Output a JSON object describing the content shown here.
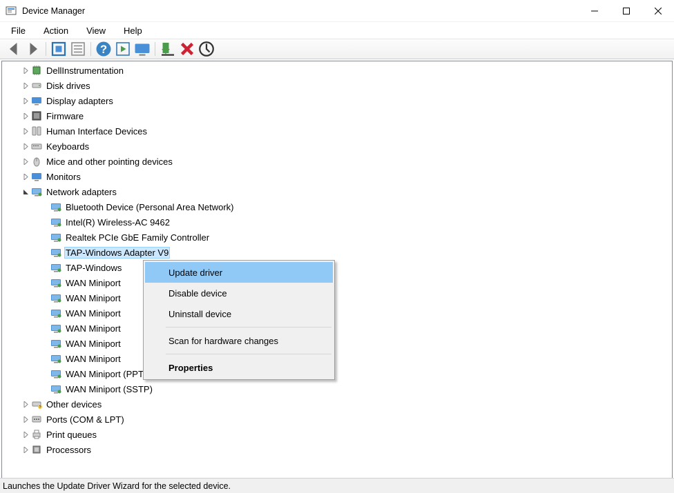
{
  "window": {
    "title": "Device Manager"
  },
  "menu": {
    "items": [
      "File",
      "Action",
      "View",
      "Help"
    ]
  },
  "toolbar": {
    "back": "back",
    "forward": "forward",
    "show_hidden": "show-hidden",
    "properties": "properties",
    "help": "help",
    "action": "action",
    "monitor": "monitor",
    "install": "install",
    "delete": "delete",
    "scan": "scan"
  },
  "tree": {
    "categories": [
      {
        "label": "DellInstrumentation",
        "icon": "chip",
        "expanded": false
      },
      {
        "label": "Disk drives",
        "icon": "disk",
        "expanded": false
      },
      {
        "label": "Display adapters",
        "icon": "display",
        "expanded": false
      },
      {
        "label": "Firmware",
        "icon": "firmware",
        "expanded": false
      },
      {
        "label": "Human Interface Devices",
        "icon": "hid",
        "expanded": false
      },
      {
        "label": "Keyboards",
        "icon": "keyboard",
        "expanded": false
      },
      {
        "label": "Mice and other pointing devices",
        "icon": "mouse",
        "expanded": false
      },
      {
        "label": "Monitors",
        "icon": "monitor",
        "expanded": false
      },
      {
        "label": "Network adapters",
        "icon": "network",
        "expanded": true,
        "children": [
          {
            "label": "Bluetooth Device (Personal Area Network)",
            "icon": "network"
          },
          {
            "label": "Intel(R) Wireless-AC 9462",
            "icon": "network"
          },
          {
            "label": "Realtek PCIe GbE Family Controller",
            "icon": "network"
          },
          {
            "label": "TAP-Windows Adapter V9",
            "icon": "network",
            "selected": true
          },
          {
            "label": "TAP-Windows",
            "icon": "network",
            "truncated": true
          },
          {
            "label": "WAN Miniport",
            "icon": "network",
            "truncated": true
          },
          {
            "label": "WAN Miniport",
            "icon": "network",
            "truncated": true
          },
          {
            "label": "WAN Miniport",
            "icon": "network",
            "truncated": true
          },
          {
            "label": "WAN Miniport",
            "icon": "network",
            "truncated": true
          },
          {
            "label": "WAN Miniport",
            "icon": "network",
            "truncated": true
          },
          {
            "label": "WAN Miniport",
            "icon": "network",
            "truncated": true
          },
          {
            "label": "WAN Miniport (PPTP)",
            "icon": "network"
          },
          {
            "label": "WAN Miniport (SSTP)",
            "icon": "network"
          }
        ]
      },
      {
        "label": "Other devices",
        "icon": "other",
        "expanded": false
      },
      {
        "label": "Ports (COM & LPT)",
        "icon": "ports",
        "expanded": false
      },
      {
        "label": "Print queues",
        "icon": "printer",
        "expanded": false
      },
      {
        "label": "Processors",
        "icon": "cpu",
        "expanded": false
      }
    ]
  },
  "context_menu": {
    "items": [
      {
        "label": "Update driver",
        "highlighted": true
      },
      {
        "label": "Disable device"
      },
      {
        "label": "Uninstall device"
      },
      {
        "separator": true
      },
      {
        "label": "Scan for hardware changes"
      },
      {
        "separator": true
      },
      {
        "label": "Properties",
        "bold": true
      }
    ]
  },
  "status_bar": {
    "text": "Launches the Update Driver Wizard for the selected device."
  }
}
